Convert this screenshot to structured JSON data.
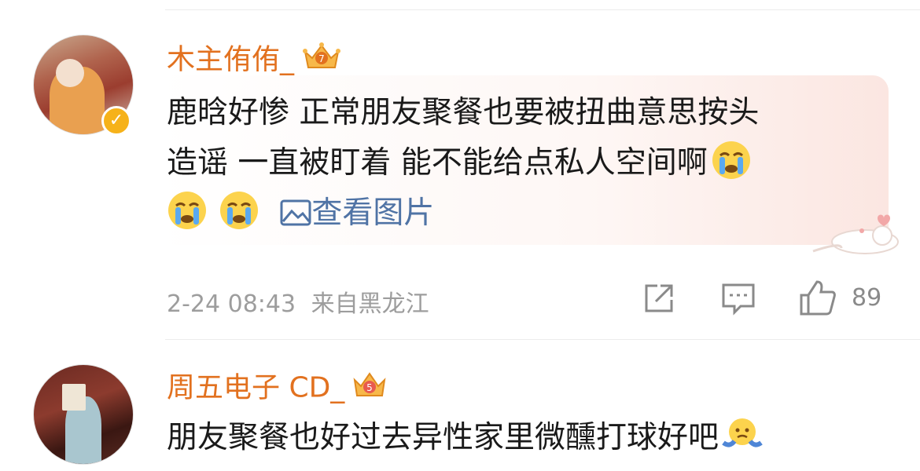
{
  "comments": [
    {
      "username": "木主侑侑_",
      "badge_level": "7",
      "text_line1": "鹿晗好惨 正常朋友聚餐也要被扭曲意思按头",
      "text_line2": "造谣 一直被盯着 能不能给点私人空间啊",
      "view_image_label": "查看图片",
      "timestamp": "2-24 08:43",
      "source": "来自黑龙江",
      "likes": "89"
    },
    {
      "username": "周五电子 CD_",
      "badge_level": "5",
      "text_line1": "朋友聚餐也好过去异性家里微醺打球好吧"
    }
  ],
  "colors": {
    "username": "#e2711f",
    "link": "#4f73a5",
    "meta": "#9d9d9d"
  },
  "icons": [
    "verified-icon",
    "crown-badge-icon",
    "crying-emoji",
    "image-icon",
    "share-icon",
    "comment-icon",
    "like-icon",
    "shrug-emoji",
    "cat-sticker"
  ]
}
